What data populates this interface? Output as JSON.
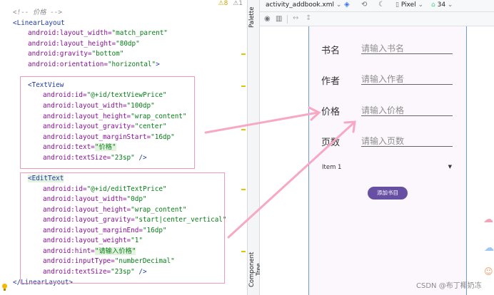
{
  "editor": {
    "inspection": {
      "warnings": "⚠8",
      "weak": "⚠1"
    },
    "lines": [
      {
        "indent": 0,
        "parts": [
          {
            "t": "<!-- ",
            "c": "cm"
          },
          {
            "t": "价格",
            "c": "cm"
          },
          {
            "t": " -->",
            "c": "cm"
          }
        ]
      },
      {
        "indent": 0,
        "parts": [
          {
            "t": "<LinearLayout",
            "c": "tag"
          }
        ]
      },
      {
        "indent": 1,
        "parts": [
          {
            "t": "android:layout_width=",
            "c": "attr"
          },
          {
            "t": "\"match_parent\"",
            "c": "val"
          }
        ]
      },
      {
        "indent": 1,
        "parts": [
          {
            "t": "android:layout_height=",
            "c": "attr"
          },
          {
            "t": "\"80dp\"",
            "c": "val"
          }
        ]
      },
      {
        "indent": 1,
        "parts": [
          {
            "t": "android:gravity=",
            "c": "attr"
          },
          {
            "t": "\"bottom\"",
            "c": "val"
          }
        ]
      },
      {
        "indent": 1,
        "parts": [
          {
            "t": "android:orientation=",
            "c": "attr"
          },
          {
            "t": "\"horizontal\"",
            "c": "val"
          },
          {
            "t": ">",
            "c": "tag"
          }
        ]
      },
      {
        "indent": 0,
        "parts": []
      },
      {
        "indent": 1,
        "parts": [
          {
            "t": "<TextView",
            "c": "tag"
          }
        ]
      },
      {
        "indent": 2,
        "parts": [
          {
            "t": "android:id=",
            "c": "attr"
          },
          {
            "t": "\"@+id/textViewPrice\"",
            "c": "val"
          }
        ]
      },
      {
        "indent": 2,
        "parts": [
          {
            "t": "android:layout_width=",
            "c": "attr"
          },
          {
            "t": "\"100dp\"",
            "c": "val"
          }
        ]
      },
      {
        "indent": 2,
        "parts": [
          {
            "t": "android:layout_height=",
            "c": "attr"
          },
          {
            "t": "\"wrap_content\"",
            "c": "val"
          }
        ]
      },
      {
        "indent": 2,
        "parts": [
          {
            "t": "android:layout_gravity=",
            "c": "attr"
          },
          {
            "t": "\"center\"",
            "c": "val"
          }
        ]
      },
      {
        "indent": 2,
        "parts": [
          {
            "t": "android:layout_marginStart=",
            "c": "attr"
          },
          {
            "t": "\"16dp\"",
            "c": "val"
          }
        ]
      },
      {
        "indent": 2,
        "parts": [
          {
            "t": "android:text=",
            "c": "attr"
          },
          {
            "t": "\"价格\"",
            "c": "val hl"
          }
        ]
      },
      {
        "indent": 2,
        "parts": [
          {
            "t": "android:textSize=",
            "c": "attr"
          },
          {
            "t": "\"23sp\"",
            "c": "val"
          },
          {
            "t": " />",
            "c": "tag"
          }
        ]
      },
      {
        "indent": 0,
        "parts": []
      },
      {
        "indent": 1,
        "parts": [
          {
            "t": "<EditText",
            "c": "tag hl"
          }
        ]
      },
      {
        "indent": 2,
        "parts": [
          {
            "t": "android:id=",
            "c": "attr"
          },
          {
            "t": "\"@+id/editTextPrice\"",
            "c": "val"
          }
        ]
      },
      {
        "indent": 2,
        "parts": [
          {
            "t": "android:layout_width=",
            "c": "attr"
          },
          {
            "t": "\"0dp\"",
            "c": "val"
          }
        ]
      },
      {
        "indent": 2,
        "parts": [
          {
            "t": "android:layout_height=",
            "c": "attr"
          },
          {
            "t": "\"wrap_content\"",
            "c": "val"
          }
        ]
      },
      {
        "indent": 2,
        "parts": [
          {
            "t": "android:layout_gravity=",
            "c": "attr"
          },
          {
            "t": "\"start|center_vertical\"",
            "c": "val"
          }
        ]
      },
      {
        "indent": 2,
        "parts": [
          {
            "t": "android:layout_marginEnd=",
            "c": "attr"
          },
          {
            "t": "\"16dp\"",
            "c": "val"
          }
        ]
      },
      {
        "indent": 2,
        "parts": [
          {
            "t": "android:layout_weight=",
            "c": "attr"
          },
          {
            "t": "\"1\"",
            "c": "val"
          }
        ]
      },
      {
        "indent": 2,
        "parts": [
          {
            "t": "android:hint=",
            "c": "attr"
          },
          {
            "t": "\"请输入价格\"",
            "c": "val hl"
          }
        ]
      },
      {
        "indent": 2,
        "parts": [
          {
            "t": "android:inputType=",
            "c": "attr"
          },
          {
            "t": "\"numberDecimal\"",
            "c": "val"
          }
        ]
      },
      {
        "indent": 2,
        "parts": [
          {
            "t": "android:textSize=",
            "c": "attr"
          },
          {
            "t": "\"23sp\"",
            "c": "val"
          },
          {
            "t": " />",
            "c": "tag"
          }
        ]
      },
      {
        "indent": 0,
        "parts": [
          {
            "t": "</LinearLayout>",
            "c": "tag"
          }
        ]
      }
    ]
  },
  "side_tabs": {
    "palette": "Palette",
    "component_tree": "Component Tree"
  },
  "design_toolbar": {
    "file_tab": "activity_addbook.xml",
    "device": "Pixel",
    "api_level": "34"
  },
  "form": {
    "fields": [
      {
        "label": "书名",
        "hint": "请输入书名"
      },
      {
        "label": "作者",
        "hint": "请输入作者"
      },
      {
        "label": "价格",
        "hint": "请输入价格"
      },
      {
        "label": "页数",
        "hint": "请输入页数"
      }
    ],
    "spinner": {
      "selected": "Item 1"
    },
    "submit_label": "添加书目"
  },
  "colors": {
    "accent": "#6750a4",
    "annotation": "#f19ab8",
    "phone_border": "#6c9bd8"
  },
  "watermark": "CSDN @布丁椰奶冻"
}
